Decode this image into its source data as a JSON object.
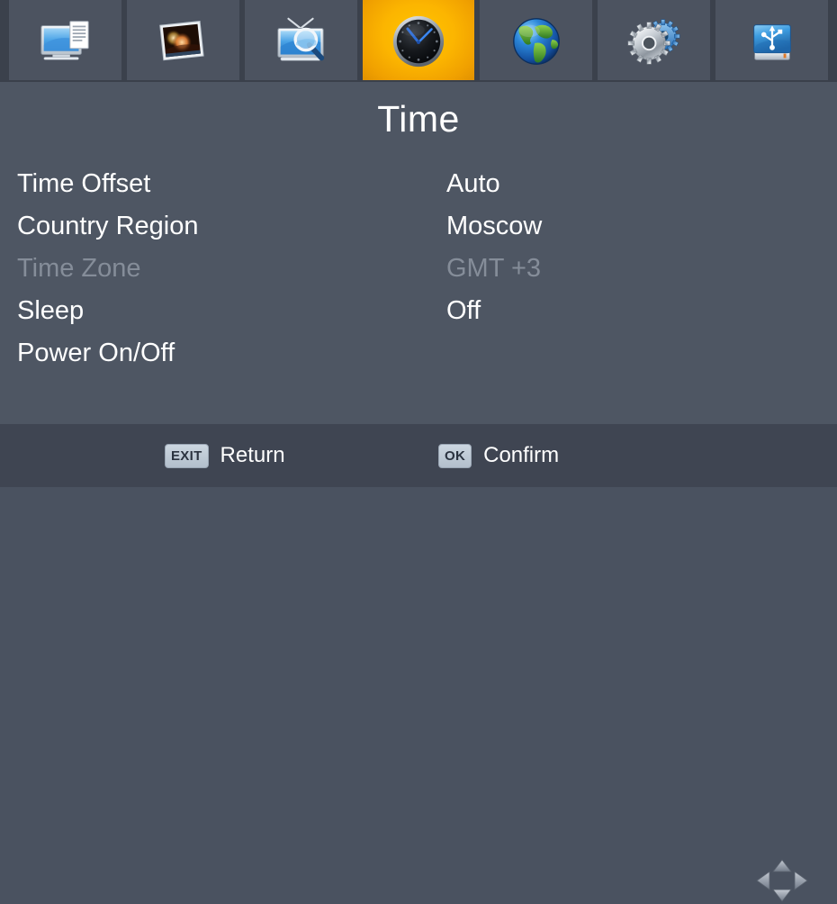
{
  "colors": {
    "background": "#4e5663",
    "tabbar_background": "#454c58",
    "tab_background": "#4c5360",
    "tab_separator": "#3b414c",
    "selected_tab_accent": "#fcb500",
    "footer_background": "#3f4552",
    "text_primary": "#ffffff",
    "text_disabled": "#858d99",
    "key_badge": "#b8c4d0"
  },
  "tabbar": {
    "tabs": [
      {
        "name": "system-setup",
        "icon": "monitor-document-icon",
        "selected": false
      },
      {
        "name": "picture-settings",
        "icon": "photo-icon",
        "selected": false
      },
      {
        "name": "channel-search",
        "icon": "tv-magnifier-icon",
        "selected": false
      },
      {
        "name": "time",
        "icon": "clock-icon",
        "selected": true
      },
      {
        "name": "network",
        "icon": "globe-icon",
        "selected": false
      },
      {
        "name": "settings",
        "icon": "gears-icon",
        "selected": false
      },
      {
        "name": "usb-media",
        "icon": "usb-drive-icon",
        "selected": false
      }
    ]
  },
  "main": {
    "title": "Time",
    "rows": [
      {
        "label": "Time Offset",
        "value": "Auto",
        "disabled": false
      },
      {
        "label": "Country Region",
        "value": "Moscow",
        "disabled": false
      },
      {
        "label": "Time Zone",
        "value": "GMT +3",
        "disabled": true
      },
      {
        "label": "Sleep",
        "value": "Off",
        "disabled": false
      },
      {
        "label": "Power On/Off",
        "value": "",
        "disabled": false
      }
    ]
  },
  "footer": {
    "hints": [
      {
        "key": "EXIT",
        "label": "Return"
      },
      {
        "key": "OK",
        "label": "Confirm"
      }
    ],
    "navpad_icon": "direction-pad-icon"
  }
}
